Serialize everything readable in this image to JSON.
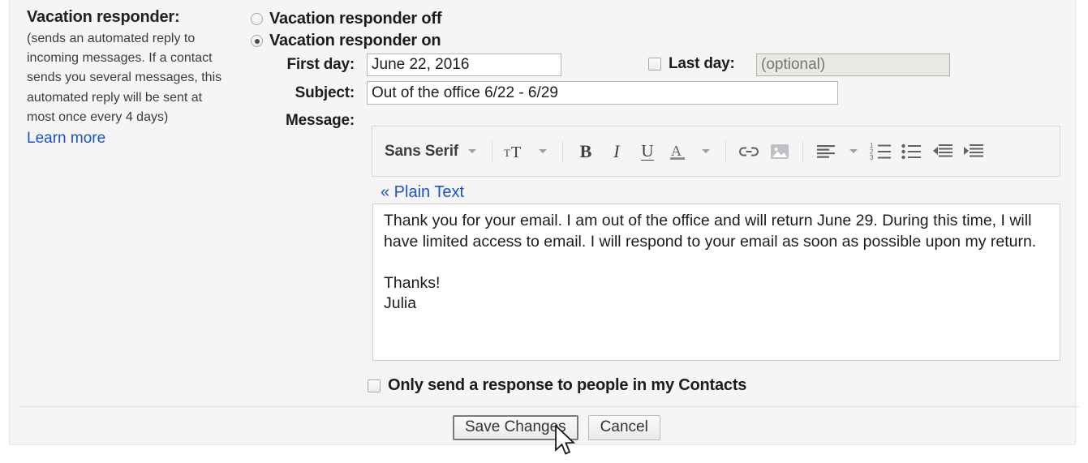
{
  "settings": {
    "description": {
      "title": "Vacation responder:",
      "body": "(sends an automated reply to incoming messages. If a contact sends you several messages, this automated reply will be sent at most once every 4 days)",
      "learn_more": "Learn more"
    },
    "radios": {
      "off_label": "Vacation responder off",
      "on_label": "Vacation responder on",
      "selected": "on"
    },
    "first_day": {
      "label": "First day:",
      "value": "June 22, 2016"
    },
    "last_day": {
      "label": "Last day:",
      "value": "",
      "placeholder": "(optional)",
      "checked": false,
      "disabled": true
    },
    "subject": {
      "label": "Subject:",
      "value": "Out of the office 6/22 - 6/29"
    },
    "message": {
      "label": "Message:",
      "plain_text_link": "« Plain Text",
      "body": "Thank you for your email. I am out of the office and will return June 29. During this time, I will have limited access to email. I will respond to your email as soon as possible upon my return.\n\nThanks!\nJulia"
    },
    "contacts_only": {
      "label": "Only send a response to people in my Contacts",
      "checked": false
    },
    "footer": {
      "save_label": "Save Changes",
      "cancel_label": "Cancel"
    }
  },
  "editor_toolbar": {
    "font_name": "Sans Serif",
    "items": [
      "font-family-dropdown",
      "font-size-dropdown",
      "bold",
      "italic",
      "underline",
      "text-color",
      "insert-link",
      "insert-image",
      "align",
      "numbered-list",
      "bulleted-list",
      "outdent",
      "indent"
    ],
    "bold_glyph": "B",
    "italic_glyph": "I",
    "underline_glyph": "U"
  },
  "colors": {
    "link": "#1a54c4",
    "panel_bg": "#f5f5f5",
    "text": "#1c1c1c",
    "icon": "#5f6368"
  }
}
